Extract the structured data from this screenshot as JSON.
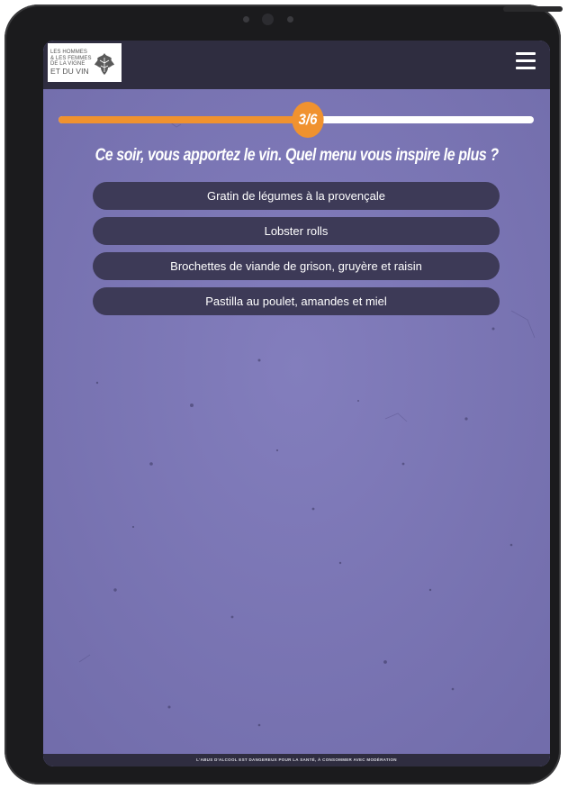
{
  "logo": {
    "lines": [
      "LES HOMMES",
      "& LES FEMMES",
      "DE LA VIGNE",
      "ET DU VIN"
    ],
    "icon": "vine-leaf-icon"
  },
  "header": {
    "menu_icon": "hamburger-menu-icon"
  },
  "progress": {
    "label": "3/6",
    "current": 3,
    "total": 6
  },
  "question": "Ce soir, vous apportez le vin. Quel menu vous inspire le plus ?",
  "options": [
    "Gratin de légumes à la provençale",
    "Lobster rolls",
    "Brochettes de viande de grison, gruyère et raisin",
    "Pastilla au poulet, amandes et miel"
  ],
  "footer": {
    "disclaimer": "L'ABUS D'ALCOOL EST DANGEREUX POUR LA SANTÉ, À CONSOMMER AVEC MODÉRATION"
  },
  "colors": {
    "background": "#7d78b7",
    "header": "#2f2d40",
    "accent": "#f0922f",
    "option_button": "#3d3a57"
  }
}
